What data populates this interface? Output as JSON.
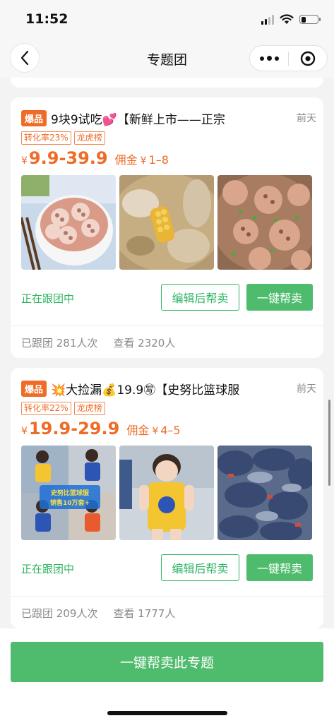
{
  "status_bar": {
    "time": "11:52",
    "battery_level": 0.3
  },
  "nav": {
    "title": "专题团",
    "back_icon": "chevron-left-icon",
    "more_icon": "more-dots-icon",
    "close_icon": "target-circle-icon"
  },
  "cards": [
    {
      "badge": "爆品",
      "title": "9块9试吃💕【新鲜上市——正宗",
      "time": "前天",
      "tags": [
        "转化率23%",
        "龙虎榜"
      ],
      "price_symbol": "¥",
      "price": "9.9-39.9",
      "commission_label": "佣金",
      "commission_symbol": "¥",
      "commission": "1–8",
      "images": [
        "lotus-root-bowl-photo",
        "lotus-soup-corn-photo",
        "lotus-stew-photo"
      ],
      "status": "正在跟团中",
      "edit_button": "编辑后帮卖",
      "sell_button": "一键帮卖",
      "followed": "已跟团 281人次",
      "views": "查看 2320人"
    },
    {
      "badge": "爆品",
      "title": "💥大捡漏💰19.9㊢【史努比篮球服",
      "time": "前天",
      "tags": [
        "转化率22%",
        "龙虎榜"
      ],
      "price_symbol": "¥",
      "price": "19.9-29.9",
      "commission_label": "佣金",
      "commission_symbol": "¥",
      "commission": "4–5",
      "images": [
        "kids-basketball-jersey-collage-photo",
        "toddler-yellow-jersey-photo",
        "jersey-pile-photo"
      ],
      "image_overlay_text": [
        "史努比篮球服",
        "销售10万套+"
      ],
      "status": "正在跟团中",
      "edit_button": "编辑后帮卖",
      "sell_button": "一键帮卖",
      "followed": "已跟团 209人次",
      "views": "查看 1777人"
    }
  ],
  "bottom": {
    "main_button": "一键帮卖此专题"
  },
  "colors": {
    "accent_green": "#4fbc6d",
    "accent_orange": "#ee6c27",
    "background": "#f3f3f3"
  }
}
